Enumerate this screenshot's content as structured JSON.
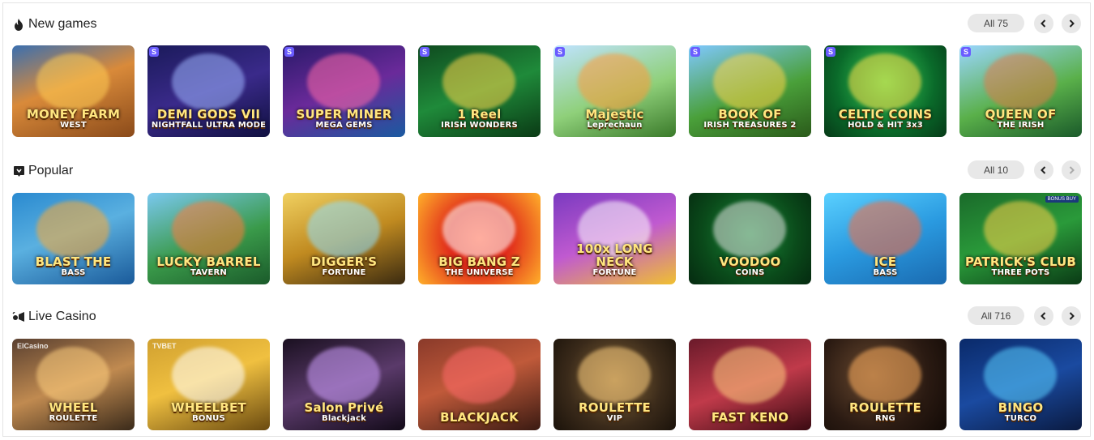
{
  "sections": [
    {
      "title": "New games",
      "icon": "flame-icon",
      "all_label": "All 75",
      "prev_enabled": true,
      "next_enabled": true,
      "games": [
        {
          "title": "MONEY FARM",
          "sub": "WEST",
          "bg": "linear-gradient(160deg,#3a6fb0 0%,#d98a3a 45%,#8a4a1a 100%)",
          "glow": "#ffcc55",
          "badge": false
        },
        {
          "title": "DEMI GODS VII",
          "sub": "NIGHTFALL ULTRA MODE",
          "bg": "linear-gradient(160deg,#1a1a5a 0%,#3a2a8a 50%,#101040 100%)",
          "glow": "#9fb6ff",
          "badge": true
        },
        {
          "title": "SUPER MINER",
          "sub": "MEGA GEMS",
          "bg": "linear-gradient(160deg,#2a1a6a 0%,#6a2a9a 50%,#1a5aa0 100%)",
          "glow": "#ff6aa8",
          "badge": true
        },
        {
          "title": "1 Reel",
          "sub": "IRISH WONDERS",
          "bg": "linear-gradient(160deg,#0f4a1f 0%,#1f8a3a 50%,#0a3a15 100%)",
          "glow": "#ffd34a",
          "badge": true
        },
        {
          "title": "Majestic",
          "sub": "Leprechaun",
          "bg": "linear-gradient(160deg,#bfe3ff 0%,#8fd07a 55%,#3a7a2a 100%)",
          "glow": "#ff9a3a",
          "badge": true
        },
        {
          "title": "BOOK OF",
          "sub": "IRISH TREASURES 2",
          "bg": "linear-gradient(160deg,#7fc8ff 0%,#4aa03a 55%,#2a5a1a 100%)",
          "glow": "#ffd34a",
          "badge": true
        },
        {
          "title": "CELTIC COINS",
          "sub": "HOLD & HIT 3x3",
          "bg": "radial-gradient(circle at 50% 40%,#3ad05a 0%,#0a6a2a 60%,#063a18 100%)",
          "glow": "#ffe14a",
          "badge": true
        },
        {
          "title": "QUEEN OF",
          "sub": "THE IRISH",
          "bg": "linear-gradient(160deg,#9ad6ff 0%,#5ab04a 55%,#1a5a2a 100%)",
          "glow": "#e07a4a",
          "badge": true
        }
      ]
    },
    {
      "title": "Popular",
      "icon": "chat-badge-icon",
      "all_label": "All 10",
      "prev_enabled": true,
      "next_enabled": false,
      "games": [
        {
          "title": "BLAST THE",
          "sub": "BASS",
          "bg": "linear-gradient(160deg,#2a8ad0 0%,#5ab0e0 45%,#1a5a9a 100%)",
          "glow": "#ffaa33",
          "badge": false
        },
        {
          "title": "LUCKY BARREL",
          "sub": "TAVERN",
          "bg": "linear-gradient(160deg,#7ac8f0 0%,#3a9a4a 55%,#1a5a2a 100%)",
          "glow": "#ff7a3a",
          "badge": false
        },
        {
          "title": "DIGGER'S",
          "sub": "FORTUNE",
          "bg": "linear-gradient(160deg,#f0d060 0%,#c08a20 50%,#3a2a10 100%)",
          "glow": "#8fe0ff",
          "badge": false
        },
        {
          "title": "BIG BANG Z",
          "sub": "THE UNIVERSE",
          "bg": "radial-gradient(circle at 50% 50%,#ff4a2a 0%,#e02a1a 40%,#ffb02a 100%)",
          "glow": "#ffffff",
          "badge": false
        },
        {
          "title": "100x LONG NECK",
          "sub": "FORTUNE",
          "bg": "linear-gradient(160deg,#7a3ac0 0%,#c05ad0 50%,#f0c030 100%)",
          "glow": "#ffffff",
          "badge": false
        },
        {
          "title": "VOODOO",
          "sub": "COINS",
          "bg": "radial-gradient(circle at 50% 45%,#1a8a3a 0%,#0a4a1a 60%,#052a10 100%)",
          "glow": "#e0e0e0",
          "badge": false
        },
        {
          "title": "ICE",
          "sub": "BASS",
          "bg": "linear-gradient(160deg,#5ad0ff 0%,#2a9ae0 50%,#1a6ab0 100%)",
          "glow": "#ff6a3a",
          "badge": false
        },
        {
          "title": "PATRICK'S CLUB",
          "sub": "THREE POTS",
          "bg": "linear-gradient(160deg,#1a6a2a 0%,#2a9a3a 50%,#0a3a15 100%)",
          "glow": "#ffd34a",
          "badge": false,
          "tag": "BONUS BUY"
        }
      ]
    },
    {
      "title": "Live Casino",
      "icon": "live-camera-icon",
      "all_label": "All 716",
      "prev_enabled": true,
      "next_enabled": true,
      "games": [
        {
          "title": "WHEEL",
          "sub": "ROULETTE",
          "bg": "linear-gradient(160deg,#5a4030 0%,#c08a50 50%,#3a2a1a 100%)",
          "glow": "#ffd080",
          "badge": false,
          "provider": "ElCasino"
        },
        {
          "title": "WHEELBET",
          "sub": "BONUS",
          "bg": "linear-gradient(160deg,#d0a030 0%,#f0c040 45%,#6a4a10 100%)",
          "glow": "#ffffff",
          "badge": false,
          "provider": "TVBET"
        },
        {
          "title": "Salon Privé",
          "sub": "Blackjack",
          "bg": "linear-gradient(160deg,#1a1020 0%,#5a3a6a 50%,#120a18 100%)",
          "glow": "#d0a0ff",
          "badge": false
        },
        {
          "title": "BLACKJACK",
          "sub": "",
          "bg": "linear-gradient(160deg,#8a3a2a 0%,#c05a3a 45%,#3a1a12 100%)",
          "glow": "#ff6a6a",
          "badge": false
        },
        {
          "title": "ROULETTE",
          "sub": "VIP",
          "bg": "radial-gradient(circle at 50% 45%,#8a6a3a 0%,#3a2a1a 60%,#1a120a 100%)",
          "glow": "#ffd080",
          "badge": false
        },
        {
          "title": "FAST KENO",
          "sub": "",
          "bg": "linear-gradient(160deg,#6a1a2a 0%,#c03a4a 50%,#3a0a12 100%)",
          "glow": "#ffd080",
          "badge": false
        },
        {
          "title": "ROULETTE",
          "sub": "RNG",
          "bg": "radial-gradient(circle at 40% 40%,#6a4a30 0%,#2a1a12 60%,#120a06 100%)",
          "glow": "#ffb060",
          "badge": false
        },
        {
          "title": "BINGO",
          "sub": "TURCO",
          "bg": "linear-gradient(160deg,#0a2a6a 0%,#1a4aa0 50%,#0a1a40 100%)",
          "glow": "#5ad0ff",
          "badge": false
        }
      ]
    }
  ]
}
